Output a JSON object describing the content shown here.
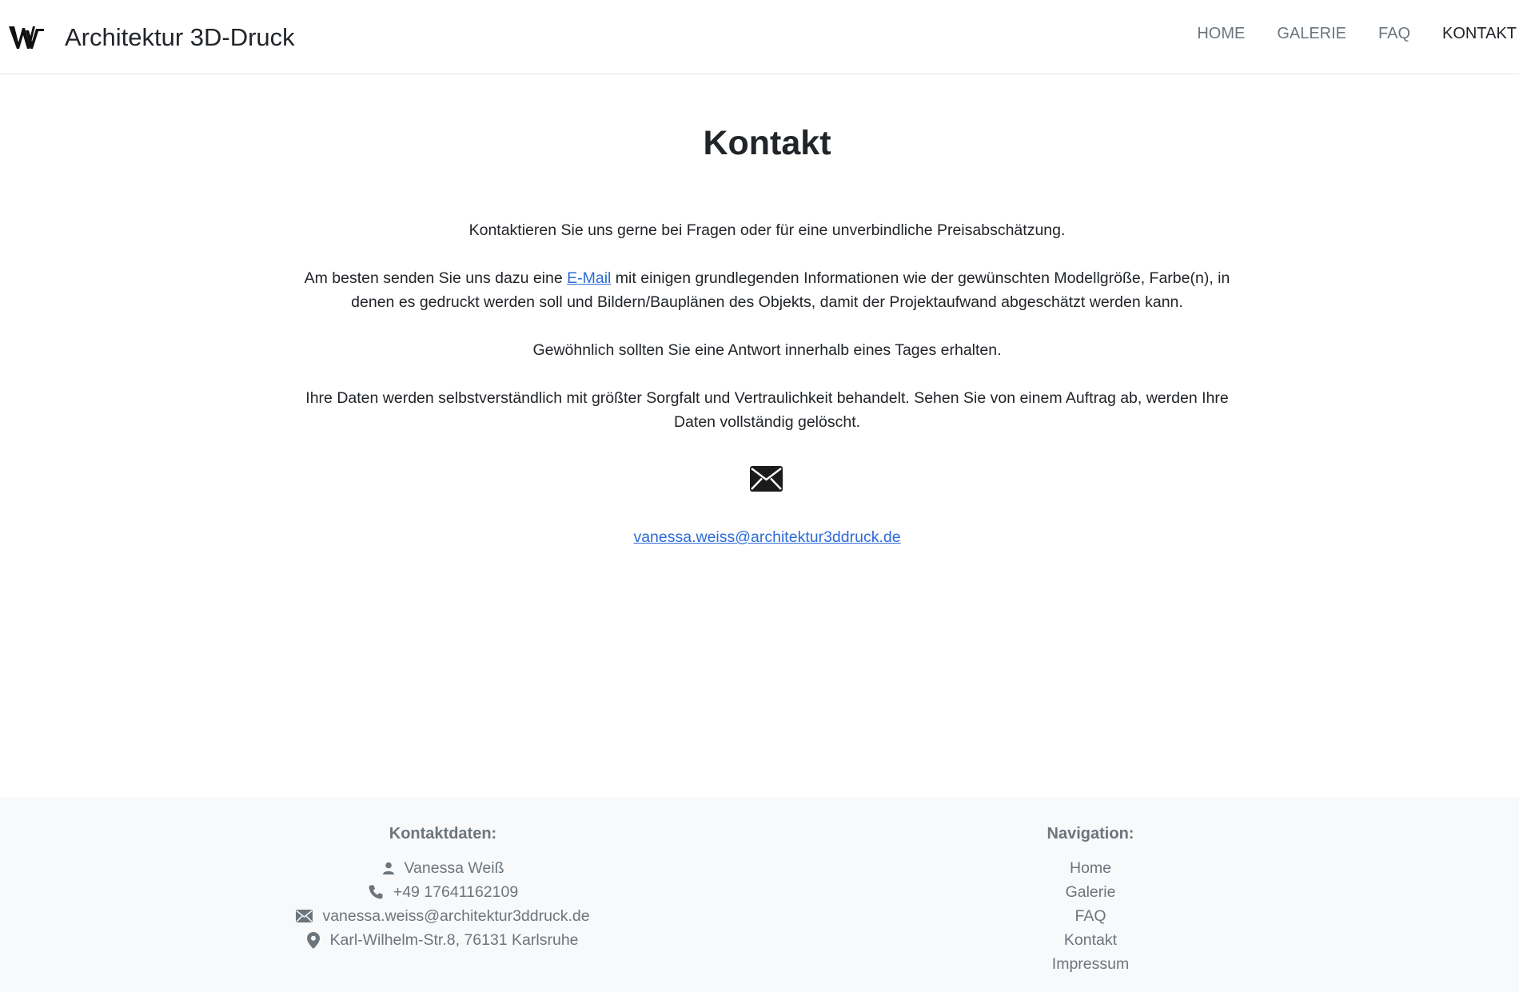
{
  "header": {
    "brand_title": "Architektur 3D-Druck",
    "logo_icon": "vw-monogram-logo",
    "nav": [
      {
        "label": "HOME",
        "active": false
      },
      {
        "label": "GALERIE",
        "active": false
      },
      {
        "label": "FAQ",
        "active": false
      },
      {
        "label": "KONTAKT",
        "active": true
      }
    ]
  },
  "main": {
    "title": "Kontakt",
    "paragraph1": "Kontaktieren Sie uns gerne bei Fragen oder für eine unverbindliche Preisabschätzung.",
    "paragraph2_before": "Am besten senden Sie uns dazu eine ",
    "paragraph2_link": "E-Mail",
    "paragraph2_after": " mit einigen grundlegenden Informationen wie der gewünschten Modellgröße, Farbe(n), in denen es gedruckt werden soll und Bildern/Bauplänen des Objekts, damit der Projektaufwand abgeschätzt werden kann.",
    "paragraph3": "Gewöhnlich sollten Sie eine Antwort innerhalb eines Tages erhalten.",
    "paragraph4": "Ihre Daten werden selbstverständlich mit größter Sorgfalt und Vertraulichkeit behandelt. Sehen Sie von einem Auftrag ab, werden Ihre Daten vollständig gelöscht.",
    "mail_icon": "envelope-icon",
    "email": "vanessa.weiss@architektur3ddruck.de"
  },
  "footer": {
    "contact": {
      "heading": "Kontaktdaten:",
      "name": "Vanessa Weiß",
      "phone": "+49 17641162109",
      "email": "vanessa.weiss@architektur3ddruck.de",
      "address": "Karl-Wilhelm-Str.8, 76131 Karlsruhe"
    },
    "navigation": {
      "heading": "Navigation:",
      "items": [
        "Home",
        "Galerie",
        "FAQ",
        "Kontakt",
        "Impressum"
      ]
    }
  },
  "colors": {
    "link": "#2c6bd8",
    "text": "#212529",
    "muted": "#6c757d",
    "footer_bg": "#f8f9fa"
  }
}
